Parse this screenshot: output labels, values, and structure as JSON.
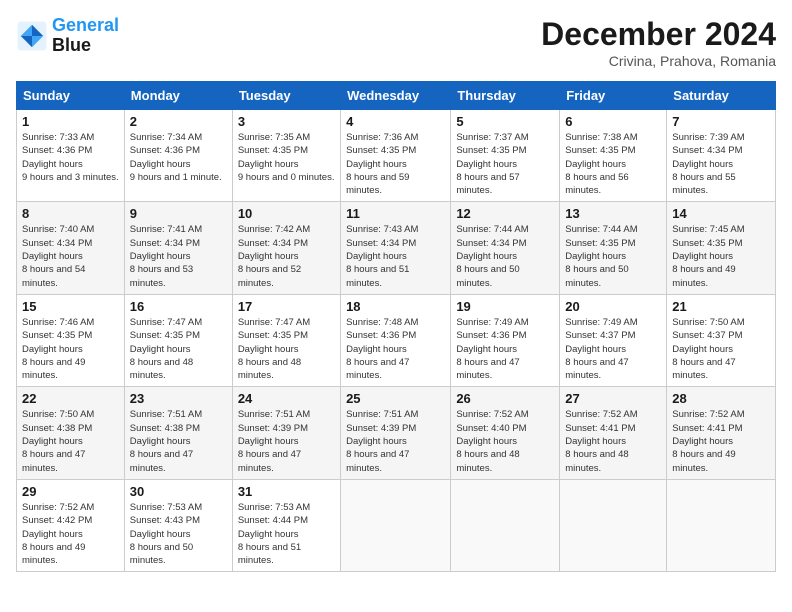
{
  "header": {
    "logo_line1": "General",
    "logo_line2": "Blue",
    "month": "December 2024",
    "location": "Crivina, Prahova, Romania"
  },
  "days_of_week": [
    "Sunday",
    "Monday",
    "Tuesday",
    "Wednesday",
    "Thursday",
    "Friday",
    "Saturday"
  ],
  "weeks": [
    [
      {
        "day": "1",
        "sunrise": "7:33 AM",
        "sunset": "4:36 PM",
        "daylight": "9 hours and 3 minutes."
      },
      {
        "day": "2",
        "sunrise": "7:34 AM",
        "sunset": "4:36 PM",
        "daylight": "9 hours and 1 minute."
      },
      {
        "day": "3",
        "sunrise": "7:35 AM",
        "sunset": "4:35 PM",
        "daylight": "9 hours and 0 minutes."
      },
      {
        "day": "4",
        "sunrise": "7:36 AM",
        "sunset": "4:35 PM",
        "daylight": "8 hours and 59 minutes."
      },
      {
        "day": "5",
        "sunrise": "7:37 AM",
        "sunset": "4:35 PM",
        "daylight": "8 hours and 57 minutes."
      },
      {
        "day": "6",
        "sunrise": "7:38 AM",
        "sunset": "4:35 PM",
        "daylight": "8 hours and 56 minutes."
      },
      {
        "day": "7",
        "sunrise": "7:39 AM",
        "sunset": "4:34 PM",
        "daylight": "8 hours and 55 minutes."
      }
    ],
    [
      {
        "day": "8",
        "sunrise": "7:40 AM",
        "sunset": "4:34 PM",
        "daylight": "8 hours and 54 minutes."
      },
      {
        "day": "9",
        "sunrise": "7:41 AM",
        "sunset": "4:34 PM",
        "daylight": "8 hours and 53 minutes."
      },
      {
        "day": "10",
        "sunrise": "7:42 AM",
        "sunset": "4:34 PM",
        "daylight": "8 hours and 52 minutes."
      },
      {
        "day": "11",
        "sunrise": "7:43 AM",
        "sunset": "4:34 PM",
        "daylight": "8 hours and 51 minutes."
      },
      {
        "day": "12",
        "sunrise": "7:44 AM",
        "sunset": "4:34 PM",
        "daylight": "8 hours and 50 minutes."
      },
      {
        "day": "13",
        "sunrise": "7:44 AM",
        "sunset": "4:35 PM",
        "daylight": "8 hours and 50 minutes."
      },
      {
        "day": "14",
        "sunrise": "7:45 AM",
        "sunset": "4:35 PM",
        "daylight": "8 hours and 49 minutes."
      }
    ],
    [
      {
        "day": "15",
        "sunrise": "7:46 AM",
        "sunset": "4:35 PM",
        "daylight": "8 hours and 49 minutes."
      },
      {
        "day": "16",
        "sunrise": "7:47 AM",
        "sunset": "4:35 PM",
        "daylight": "8 hours and 48 minutes."
      },
      {
        "day": "17",
        "sunrise": "7:47 AM",
        "sunset": "4:35 PM",
        "daylight": "8 hours and 48 minutes."
      },
      {
        "day": "18",
        "sunrise": "7:48 AM",
        "sunset": "4:36 PM",
        "daylight": "8 hours and 47 minutes."
      },
      {
        "day": "19",
        "sunrise": "7:49 AM",
        "sunset": "4:36 PM",
        "daylight": "8 hours and 47 minutes."
      },
      {
        "day": "20",
        "sunrise": "7:49 AM",
        "sunset": "4:37 PM",
        "daylight": "8 hours and 47 minutes."
      },
      {
        "day": "21",
        "sunrise": "7:50 AM",
        "sunset": "4:37 PM",
        "daylight": "8 hours and 47 minutes."
      }
    ],
    [
      {
        "day": "22",
        "sunrise": "7:50 AM",
        "sunset": "4:38 PM",
        "daylight": "8 hours and 47 minutes."
      },
      {
        "day": "23",
        "sunrise": "7:51 AM",
        "sunset": "4:38 PM",
        "daylight": "8 hours and 47 minutes."
      },
      {
        "day": "24",
        "sunrise": "7:51 AM",
        "sunset": "4:39 PM",
        "daylight": "8 hours and 47 minutes."
      },
      {
        "day": "25",
        "sunrise": "7:51 AM",
        "sunset": "4:39 PM",
        "daylight": "8 hours and 47 minutes."
      },
      {
        "day": "26",
        "sunrise": "7:52 AM",
        "sunset": "4:40 PM",
        "daylight": "8 hours and 48 minutes."
      },
      {
        "day": "27",
        "sunrise": "7:52 AM",
        "sunset": "4:41 PM",
        "daylight": "8 hours and 48 minutes."
      },
      {
        "day": "28",
        "sunrise": "7:52 AM",
        "sunset": "4:41 PM",
        "daylight": "8 hours and 49 minutes."
      }
    ],
    [
      {
        "day": "29",
        "sunrise": "7:52 AM",
        "sunset": "4:42 PM",
        "daylight": "8 hours and 49 minutes."
      },
      {
        "day": "30",
        "sunrise": "7:53 AM",
        "sunset": "4:43 PM",
        "daylight": "8 hours and 50 minutes."
      },
      {
        "day": "31",
        "sunrise": "7:53 AM",
        "sunset": "4:44 PM",
        "daylight": "8 hours and 51 minutes."
      },
      null,
      null,
      null,
      null
    ]
  ]
}
